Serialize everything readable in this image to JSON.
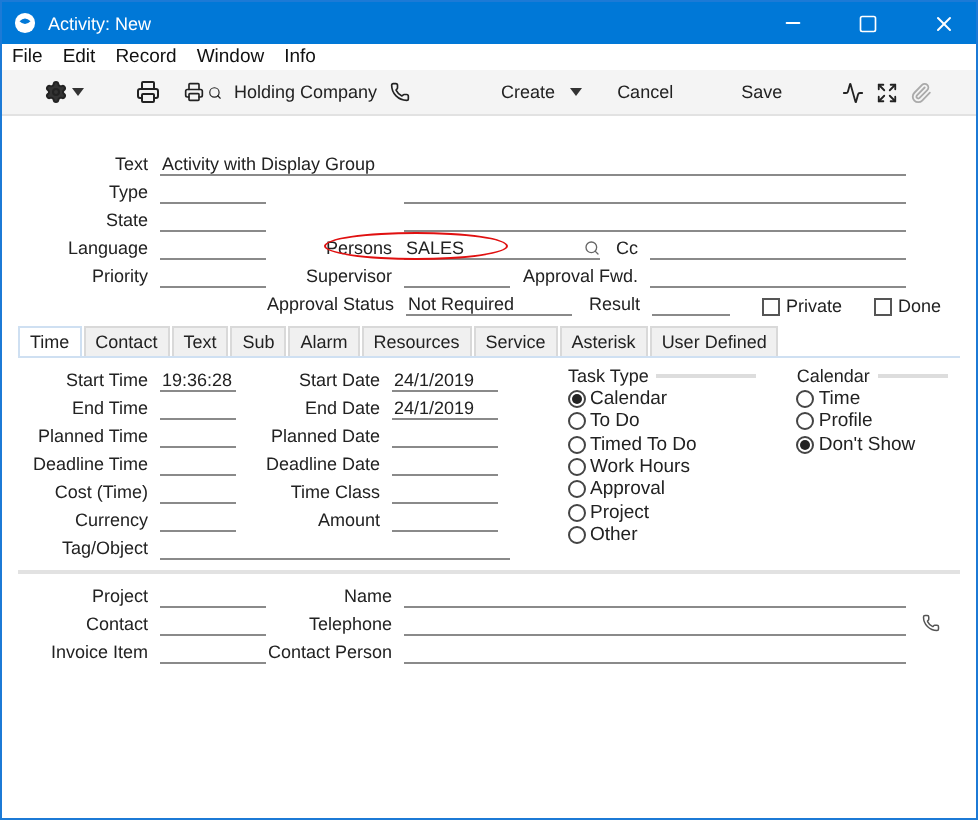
{
  "window": {
    "title": "Activity: New"
  },
  "menu": [
    "File",
    "Edit",
    "Record",
    "Window",
    "Info"
  ],
  "toolbar": {
    "company": "Holding Company",
    "create": "Create",
    "cancel": "Cancel",
    "save": "Save"
  },
  "header": {
    "text": {
      "label": "Text",
      "value": "Activity with Display Group"
    },
    "type": {
      "label": "Type"
    },
    "state": {
      "label": "State"
    },
    "language": {
      "label": "Language"
    },
    "priority": {
      "label": "Priority"
    },
    "persons": {
      "label": "Persons",
      "value": "SALES",
      "highlighted": true
    },
    "cc": {
      "label": "Cc"
    },
    "supervisor": {
      "label": "Supervisor"
    },
    "approval_fwd": {
      "label": "Approval Fwd."
    },
    "approval_status": {
      "label": "Approval Status",
      "value": "Not Required"
    },
    "result": {
      "label": "Result"
    },
    "private": {
      "label": "Private",
      "checked": false
    },
    "done": {
      "label": "Done",
      "checked": false
    }
  },
  "tabs": [
    {
      "label": "Time",
      "selected": true
    },
    {
      "label": "Contact",
      "selected": false
    },
    {
      "label": "Text",
      "selected": false
    },
    {
      "label": "Sub",
      "selected": false
    },
    {
      "label": "Alarm",
      "selected": false
    },
    {
      "label": "Resources",
      "selected": false
    },
    {
      "label": "Service",
      "selected": false
    },
    {
      "label": "Asterisk",
      "selected": false
    },
    {
      "label": "User Defined",
      "selected": false
    }
  ],
  "time": {
    "rows": [
      {
        "left": {
          "label": "Start Time",
          "value": "19:36:28"
        },
        "right": {
          "label": "Start Date",
          "value": "24/1/2019"
        }
      },
      {
        "left": {
          "label": "End Time"
        },
        "right": {
          "label": "End Date",
          "value": "24/1/2019"
        }
      },
      {
        "left": {
          "label": "Planned Time"
        },
        "right": {
          "label": "Planned Date"
        }
      },
      {
        "left": {
          "label": "Deadline Time"
        },
        "right": {
          "label": "Deadline Date"
        }
      },
      {
        "left": {
          "label": "Cost (Time)"
        },
        "right": {
          "label": "Time Class"
        }
      },
      {
        "left": {
          "label": "Currency"
        },
        "right": {
          "label": "Amount"
        }
      },
      {
        "left": {
          "label": "Tag/Object"
        }
      }
    ],
    "task_type": {
      "title": "Task Type",
      "options": [
        {
          "label": "Calendar",
          "selected": true
        },
        {
          "label": "To Do",
          "selected": false
        },
        {
          "label": "Timed To Do",
          "selected": false
        },
        {
          "label": "Work Hours",
          "selected": false
        },
        {
          "label": "Approval",
          "selected": false
        },
        {
          "label": "Project",
          "selected": false
        },
        {
          "label": "Other",
          "selected": false
        }
      ]
    },
    "calendar": {
      "title": "Calendar",
      "options": [
        {
          "label": "Time",
          "selected": false
        },
        {
          "label": "Profile",
          "selected": false
        },
        {
          "label": "Don't Show",
          "selected": true
        }
      ]
    }
  },
  "links": [
    {
      "left": {
        "label": "Project"
      },
      "right": {
        "label": "Name"
      }
    },
    {
      "left": {
        "label": "Contact"
      },
      "right": {
        "label": "Telephone"
      }
    },
    {
      "left": {
        "label": "Invoice Item"
      },
      "right": {
        "label": "Contact Person"
      }
    }
  ]
}
